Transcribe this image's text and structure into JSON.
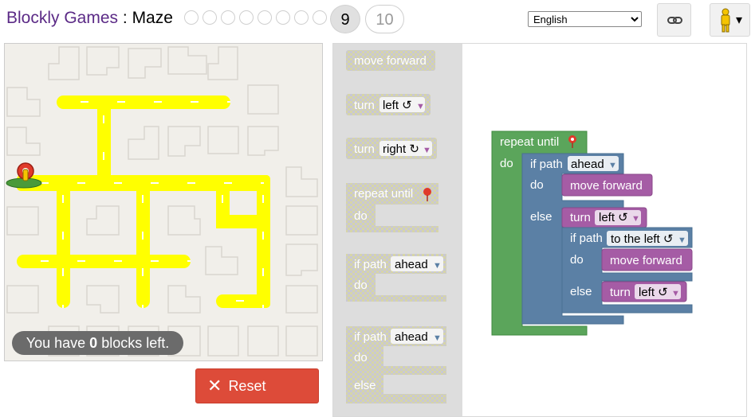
{
  "header": {
    "app_name": "Blockly Games",
    "separator": " : ",
    "game_name": "Maze",
    "current_level": "9",
    "next_level": "10",
    "language": "English"
  },
  "icons": {
    "link": "link-icon",
    "pegman": "pegman-icon",
    "dropdown": "chevron-down-icon",
    "reset": "close-icon",
    "marker": "map-marker-icon"
  },
  "status": {
    "prefix": "You have ",
    "count": "0",
    "suffix": " blocks left."
  },
  "reset_label": "Reset",
  "toolbox": {
    "move_forward": "move forward",
    "turn": "turn",
    "left": "left ↺",
    "right": "right ↻",
    "repeat_until": "repeat until",
    "do": "do",
    "if_path": "if path",
    "ahead": "ahead",
    "else": "else"
  },
  "program": {
    "repeat_until": "repeat until",
    "do": "do",
    "if_path": "if path",
    "ahead": "ahead",
    "else": "else",
    "move_forward_1": "move forward",
    "turn_1": "turn",
    "left_1": "left ↺",
    "if_path_2": "if path",
    "to_the_left": "to the left ↺",
    "do_2": "do",
    "move_forward_2": "move forward",
    "else_2": "else",
    "turn_2": "turn",
    "left_2": "left ↺"
  },
  "colors": {
    "purple": "#a55ca5",
    "blue": "#5b80a5",
    "green": "#5ba55b",
    "reset_red": "#dd4b39",
    "path_yellow": "#ffff00"
  }
}
